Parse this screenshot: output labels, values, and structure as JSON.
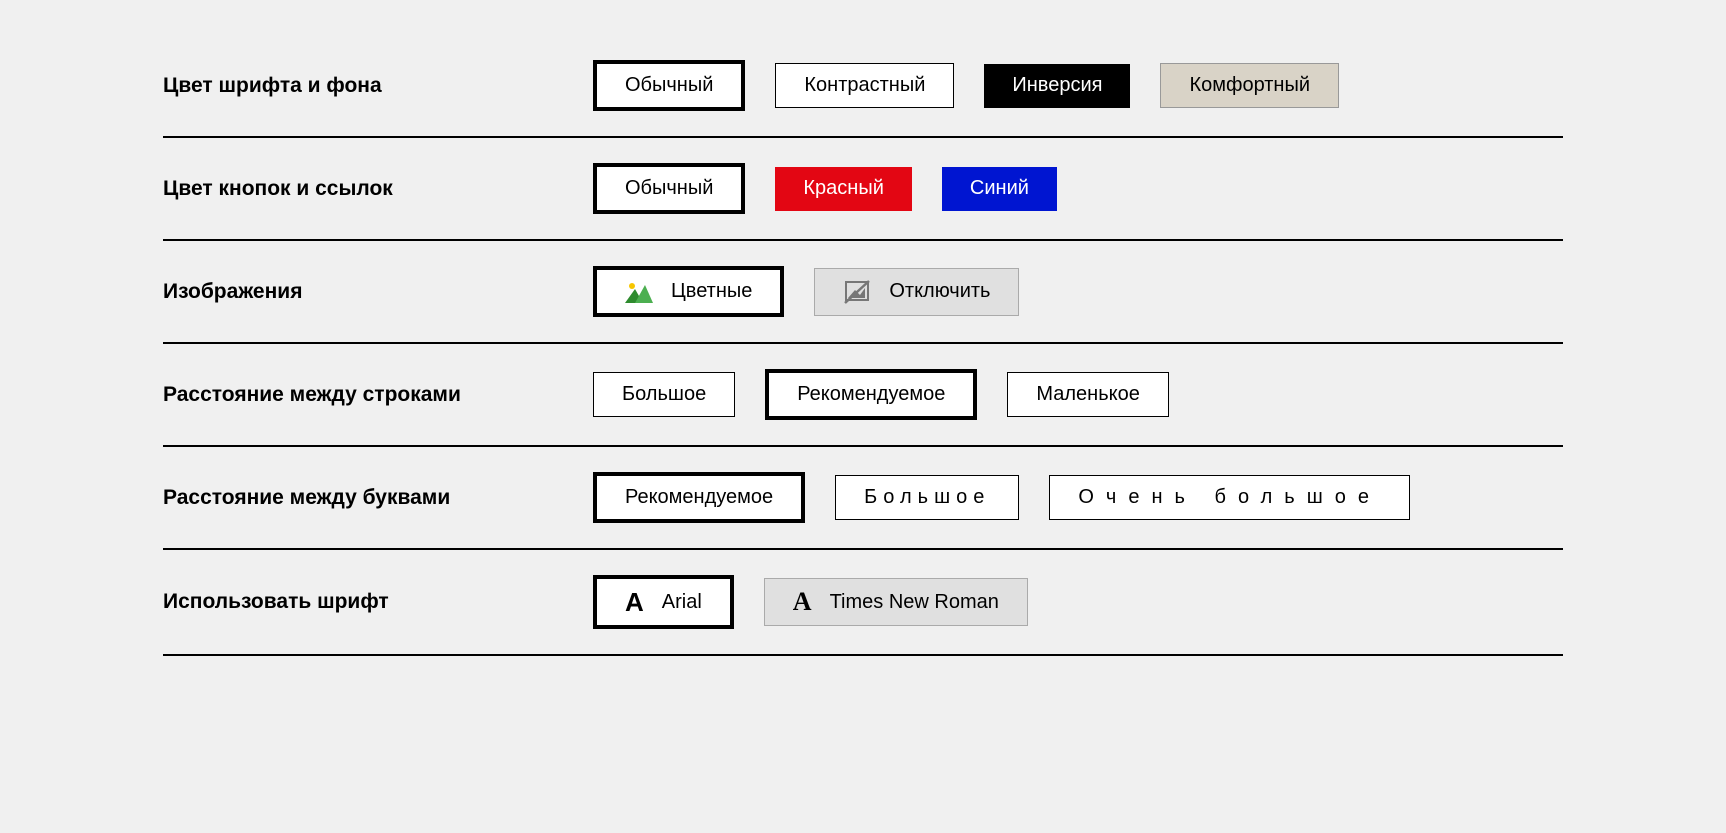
{
  "rows": {
    "colorScheme": {
      "label": "Цвет шрифта и фона",
      "options": {
        "normal": "Обычный",
        "contrast": "Контрастный",
        "inverse": "Инверсия",
        "comfort": "Комфортный"
      }
    },
    "linkColor": {
      "label": "Цвет кнопок и ссылок",
      "options": {
        "normal": "Обычный",
        "red": "Красный",
        "blue": "Синий"
      }
    },
    "images": {
      "label": "Изображения",
      "options": {
        "color": "Цветные",
        "off": "Отключить"
      }
    },
    "lineSpacing": {
      "label": "Расстояние между строками",
      "options": {
        "large": "Большое",
        "recommended": "Рекомендуемое",
        "small": "Маленькое"
      }
    },
    "letterSpacing": {
      "label": "Расстояние между буквами",
      "options": {
        "recommended": "Рекомендуемое",
        "large": "Большое",
        "xlarge": "Очень большое"
      }
    },
    "font": {
      "label": "Использовать шрифт",
      "options": {
        "arial": "Arial",
        "times": "Times New Roman"
      },
      "iconLetter": "A"
    }
  }
}
